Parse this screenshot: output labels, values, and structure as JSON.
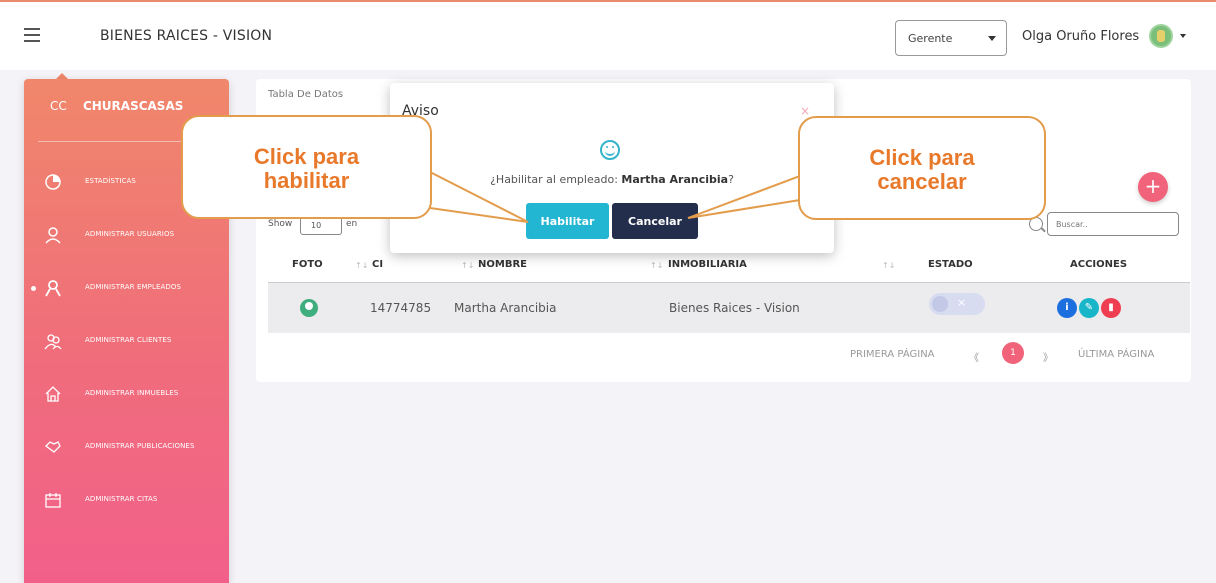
{
  "navbar": {
    "title": "BIENES RAICES - VISION",
    "role_selected": "Gerente",
    "user_name": "Olga Oruño Flores"
  },
  "sidebar": {
    "brand_short": "CC",
    "brand_name": "CHURASCASAS",
    "items": [
      {
        "label": "ESTADÍSTICAS",
        "icon": "chart-icon"
      },
      {
        "label": "ADMINISTRAR USUARIOS",
        "icon": "user-icon"
      },
      {
        "label": "ADMINISTRAR EMPLEADOS",
        "icon": "employee-icon",
        "active": true
      },
      {
        "label": "ADMINISTRAR CLIENTES",
        "icon": "clients-icon"
      },
      {
        "label": "ADMINISTRAR INMUEBLES",
        "icon": "home-icon"
      },
      {
        "label": "ADMINISTRAR PUBLICACIONES",
        "icon": "handshake-icon"
      },
      {
        "label": "ADMINISTRAR CITAS",
        "icon": "calendar-icon"
      }
    ]
  },
  "card": {
    "title": "Tabla De Datos",
    "show_label": "Show",
    "show_value": "10",
    "show_after": "en",
    "search_placeholder": "Buscar..",
    "add_label": "+"
  },
  "table": {
    "headers": [
      "FOTO",
      "CI",
      "NOMBRE",
      "INMOBILIARIA",
      "ESTADO",
      "ACCIONES"
    ],
    "rows": [
      {
        "ci": "14774785",
        "nombre": "Martha Arancibia",
        "inmobiliaria": "Bienes Raices - Vision",
        "estado_mark": "×"
      }
    ]
  },
  "pagination": {
    "first": "PRIMERA PÁGINA",
    "prev": "《",
    "current": "1",
    "next": "》",
    "last": "ÚLTIMA PÁGINA"
  },
  "modal": {
    "title": "Aviso",
    "close": "×",
    "question_prefix": "¿Habilitar al empleado: ",
    "employee": "Martha Arancibia",
    "question_suffix": "?",
    "confirm_label": "Habilitar",
    "cancel_label": "Cancelar"
  },
  "callouts": {
    "left_line1": "Click para",
    "left_line2": "habilitar",
    "right_line1": "Click para",
    "right_line2": "cancelar"
  },
  "colors": {
    "accent": "#f1637a",
    "confirm": "#22b6d3",
    "cancel": "#232e4c",
    "callout": "#e8792b"
  }
}
